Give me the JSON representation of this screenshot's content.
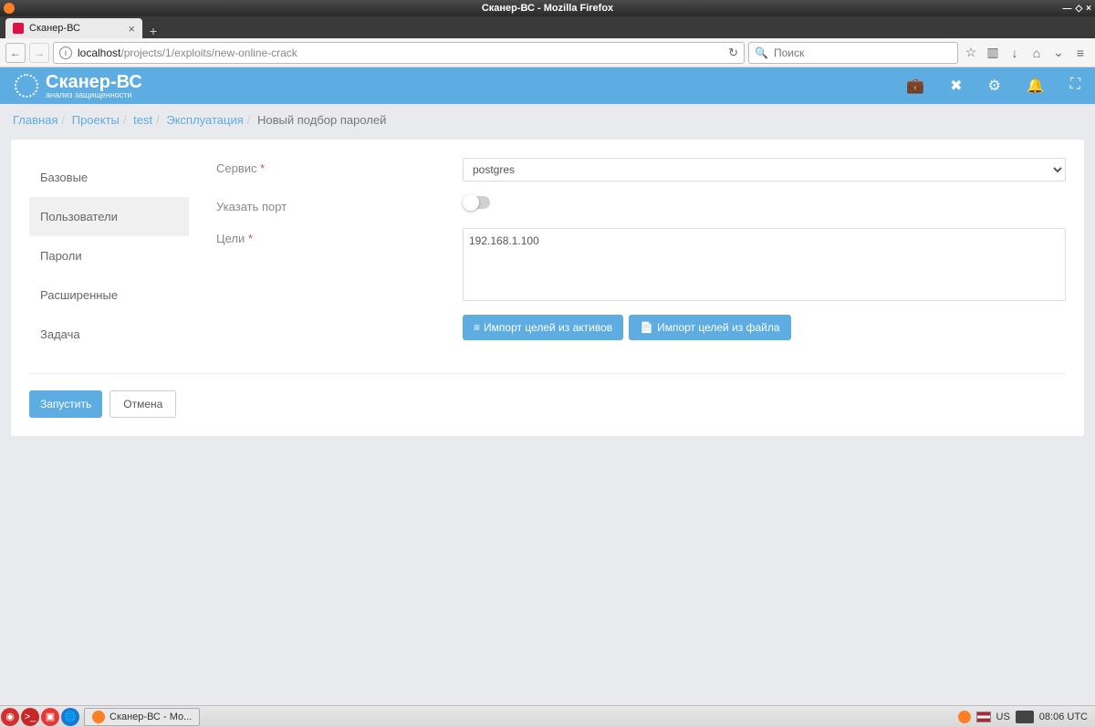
{
  "os": {
    "titlebar": "Сканер-ВС - Mozilla Firefox",
    "taskbar_task": "Сканер-ВС - Mo...",
    "lang": "US",
    "clock": "08:06 UTC"
  },
  "browser": {
    "tab_title": "Сканер-ВС",
    "url_host": "localhost",
    "url_path": "/projects/1/exploits/new-online-crack",
    "search_placeholder": "Поиск"
  },
  "app": {
    "brand": "Сканер-ВС",
    "tagline": "анализ защищенности"
  },
  "breadcrumb": {
    "items": [
      "Главная",
      "Проекты",
      "test",
      "Эксплуатация"
    ],
    "current": "Новый подбор паролей"
  },
  "tabs": {
    "items": [
      {
        "label": "Базовые"
      },
      {
        "label": "Пользователи"
      },
      {
        "label": "Пароли"
      },
      {
        "label": "Расширенные"
      },
      {
        "label": "Задача"
      }
    ]
  },
  "form": {
    "service_label": "Сервис",
    "service_value": "postgres",
    "port_label": "Указать порт",
    "targets_label": "Цели",
    "targets_value": "192.168.1.100",
    "import_assets": "Импорт целей из активов",
    "import_file": "Импорт целей из файла"
  },
  "actions": {
    "run": "Запустить",
    "cancel": "Отмена"
  }
}
